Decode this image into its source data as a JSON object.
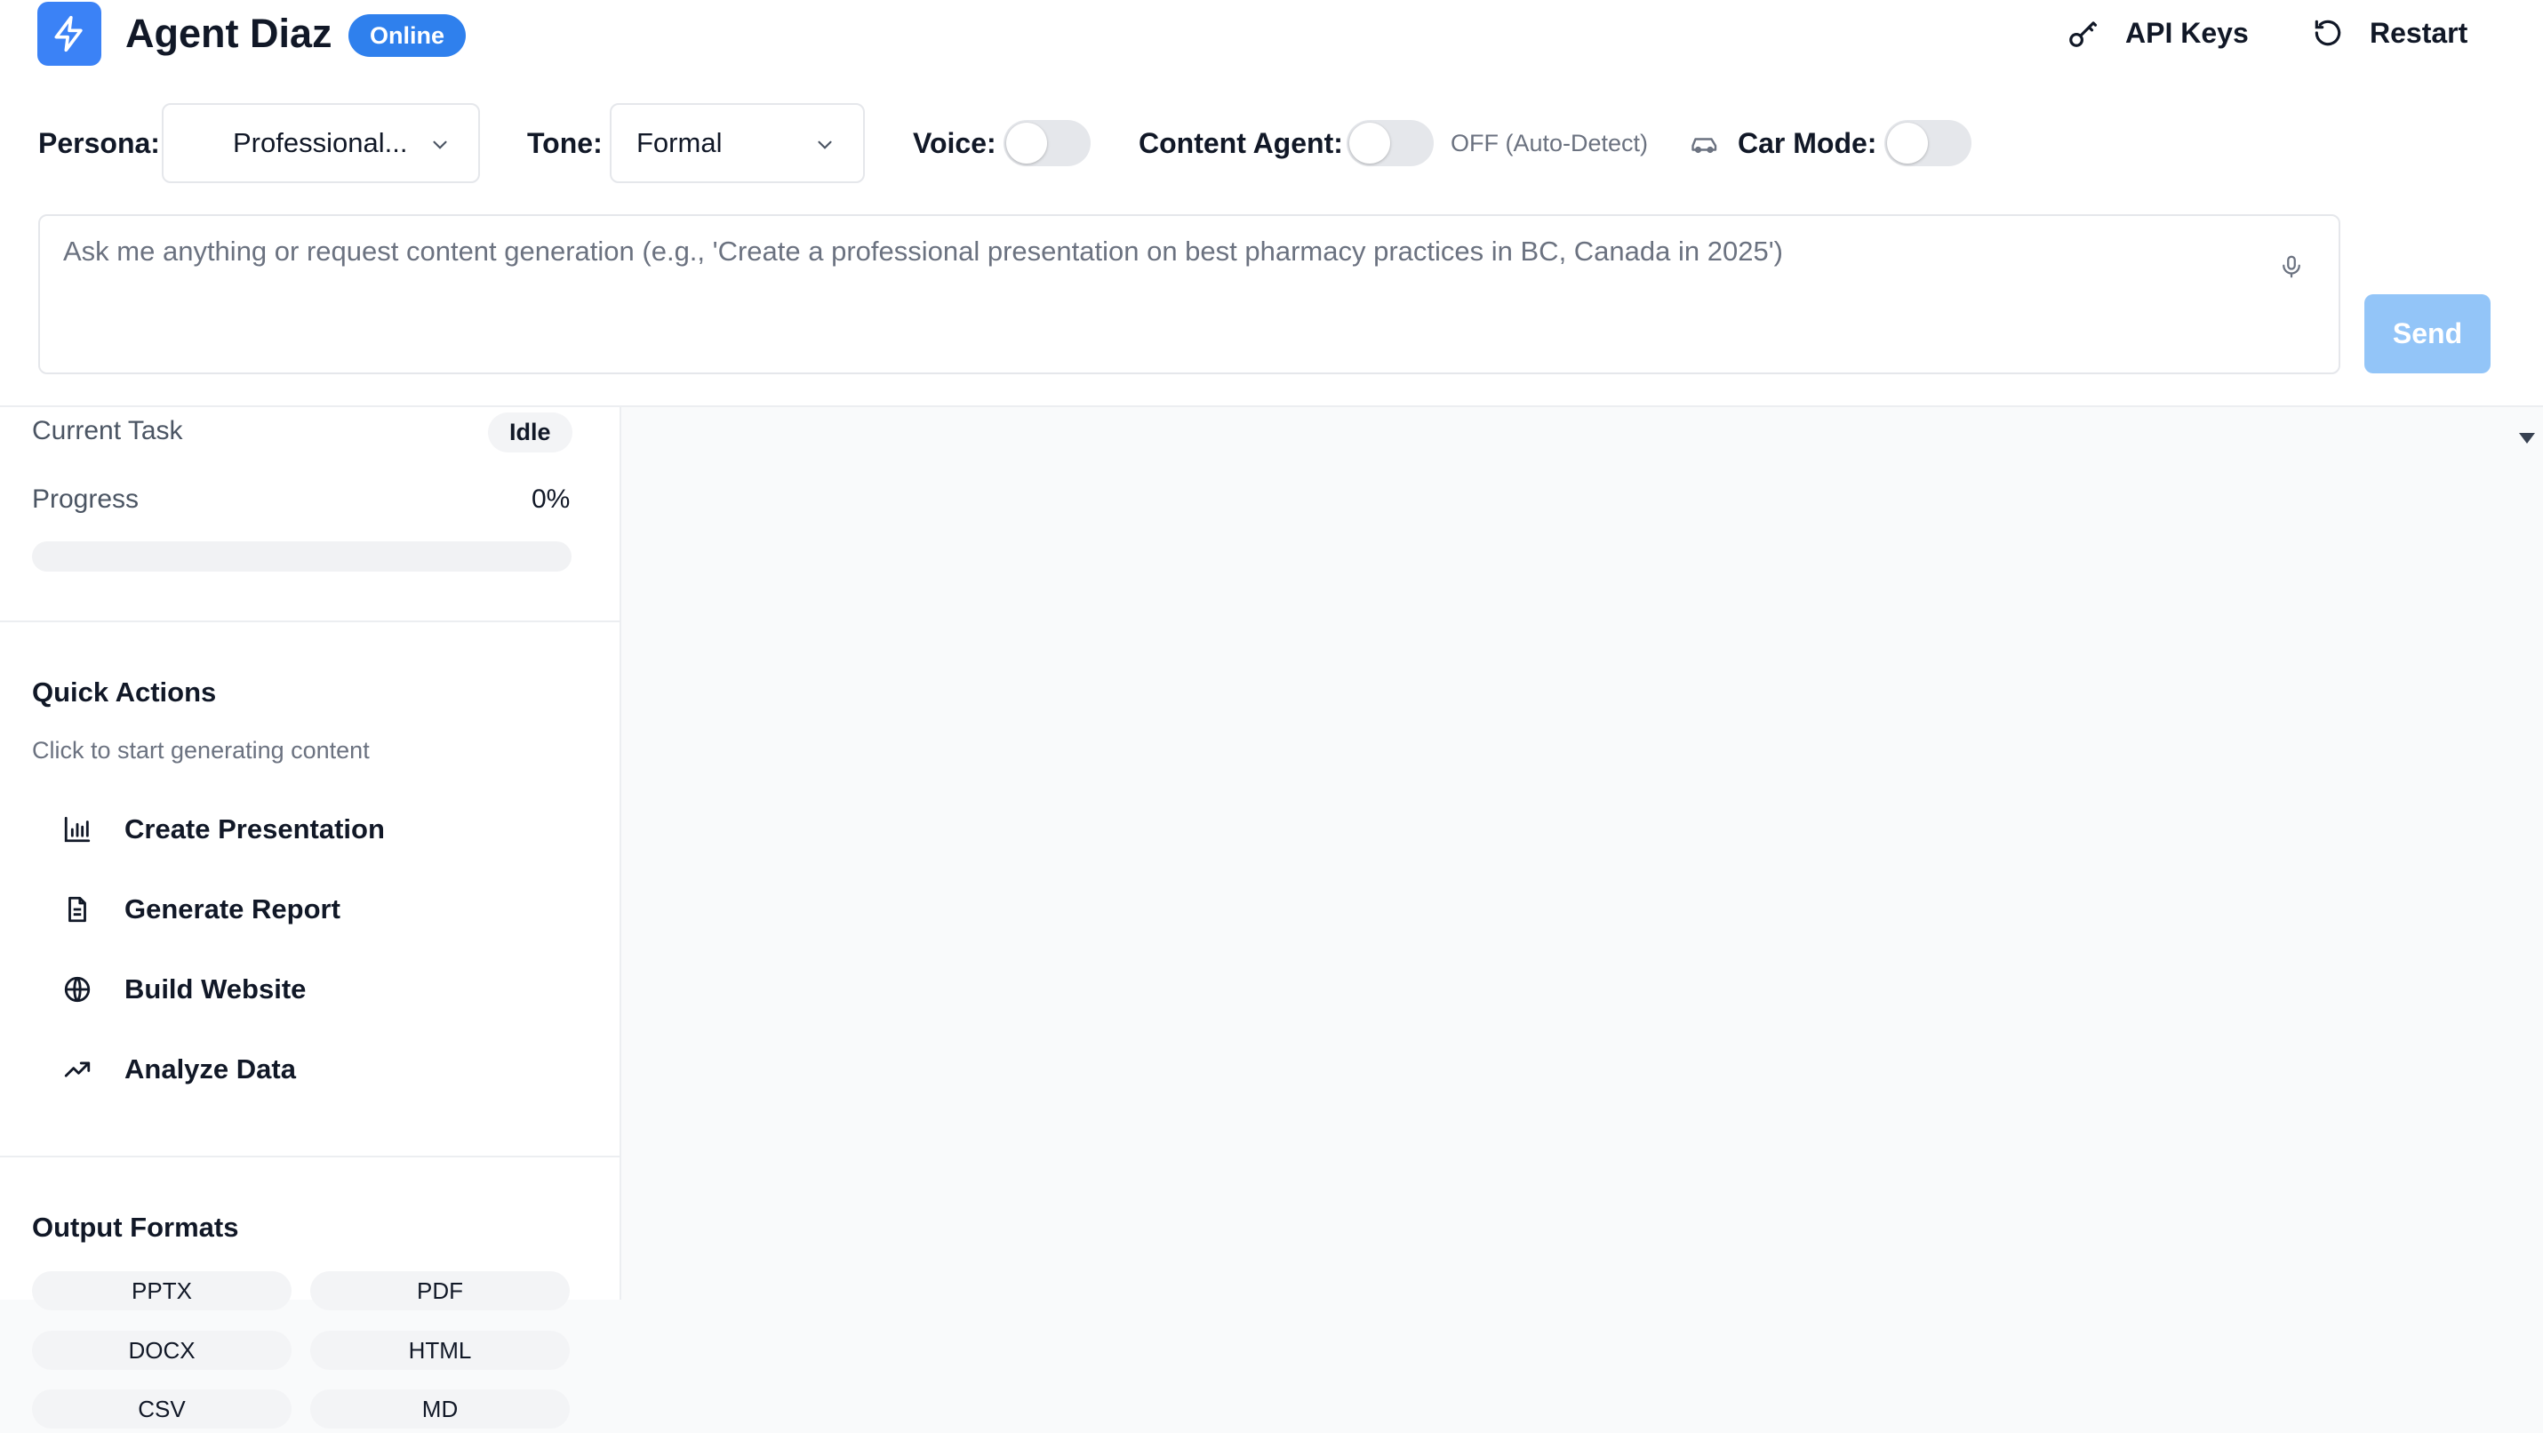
{
  "header": {
    "app_title": "Agent Diaz",
    "status_badge": "Online",
    "api_keys_label": "API Keys",
    "restart_label": "Restart",
    "logo_icon": "lightning-bolt-icon"
  },
  "controls": {
    "persona_label": "Persona:",
    "persona_value": "Professional...",
    "tone_label": "Tone:",
    "tone_value": "Formal",
    "voice_label": "Voice:",
    "voice_on": false,
    "content_agent_label": "Content Agent:",
    "content_agent_on": false,
    "content_agent_status": "OFF (Auto-Detect)",
    "car_mode_label": "Car Mode:",
    "car_mode_on": false
  },
  "prompt": {
    "placeholder": "Ask me anything or request content generation (e.g., 'Create a professional presentation on best pharmacy practices in BC, Canada in 2025')",
    "value": "",
    "send_label": "Send"
  },
  "status": {
    "current_task_label": "Current Task",
    "current_task_value": "Idle",
    "progress_label": "Progress",
    "progress_text": "0%",
    "progress_fraction": 0
  },
  "quick_actions": {
    "title": "Quick Actions",
    "subtitle": "Click to start generating content",
    "items": [
      {
        "label": "Create Presentation",
        "icon": "bar-chart-icon"
      },
      {
        "label": "Generate Report",
        "icon": "document-icon"
      },
      {
        "label": "Build Website",
        "icon": "globe-icon"
      },
      {
        "label": "Analyze Data",
        "icon": "trending-up-icon"
      }
    ]
  },
  "output_formats": {
    "title": "Output Formats",
    "items": [
      "PPTX",
      "PDF",
      "DOCX",
      "HTML",
      "CSV",
      "MD"
    ]
  },
  "colors": {
    "accent": "#3b82f6",
    "badge": "#2f80ed",
    "send_disabled": "#93c5f8",
    "toggle_off": "#e5e7eb"
  }
}
